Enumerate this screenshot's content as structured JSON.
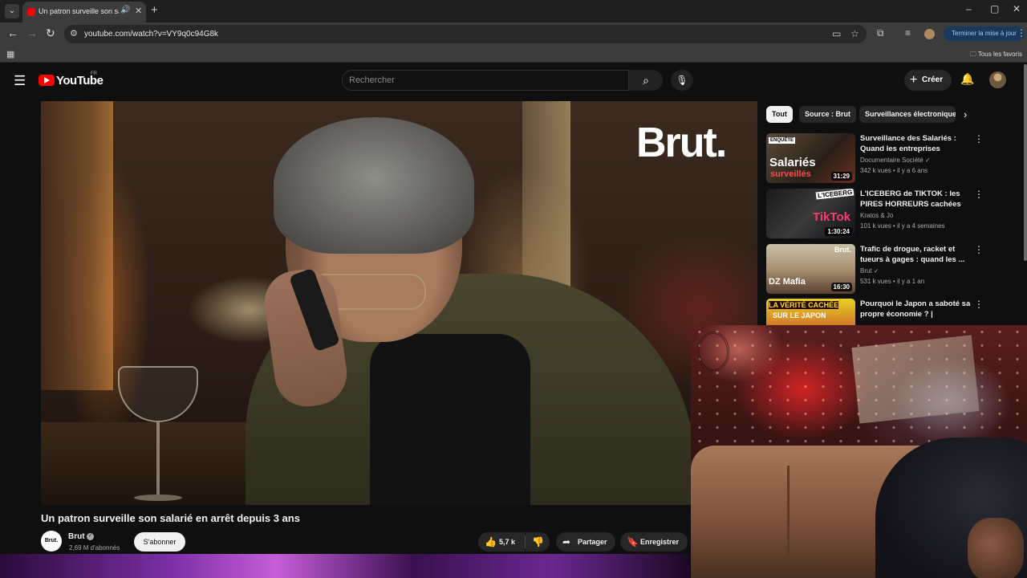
{
  "browser": {
    "tab_title": "Un patron surveille son salarié en arrêt depuis 3 ans",
    "url": "youtube.com/watch?v=VY9q0c94G8k",
    "update_button": "Terminer la mise à jour",
    "bookmarks_all": "Tous les favoris"
  },
  "youtube": {
    "logo_text": "YouTube",
    "country": "FR",
    "search_placeholder": "Rechercher",
    "create_label": "Créer"
  },
  "video": {
    "overlay_logo": "Brut.",
    "title": "Un patron surveille son salarié en arrêt depuis 3 ans",
    "channel_avatar_text": "Brut.",
    "channel": "Brut",
    "subscribers": "2,69 M d'abonnés",
    "subscribe_label": "S'abonner",
    "likes": "5,7 k",
    "share_label": "Partager",
    "save_label": "Enregistrer"
  },
  "chips": [
    "Tout",
    "Source : Brut",
    "Surveillances électroniques"
  ],
  "recommendations": [
    {
      "title": "Surveillance des Salariés : Quand les entreprises utilisent...",
      "channel": "Documentaire Société",
      "meta": "342 k vues • il y a 6 ans",
      "duration": "31:29",
      "thumb_badge": "ENQUÊTE",
      "thumb_text1": "Salariés",
      "thumb_text2": "surveillés"
    },
    {
      "title": "L'ICEBERG de TIKTOK : les PIRES HORREURS cachées de...",
      "channel": "Kratos & Jo",
      "meta": "101 k vues • il y a 4 semaines",
      "duration": "1:30:24",
      "thumb_text1": "L'ICEBERG",
      "thumb_text2": "TikTok"
    },
    {
      "title": "Trafic de drogue, racket et tueurs à gages : quand les ...",
      "channel": "Brut",
      "meta": "531 k vues • il y a 1 an",
      "duration": "16:30",
      "thumb_text1": "DZ Mafia",
      "thumb_text2": "Brut."
    },
    {
      "title": "Pourquoi le Japon a saboté sa propre économie ? | Profonde...",
      "channel": "",
      "meta": "",
      "duration": "",
      "thumb_text1": "LA VÉRITÉ CACHÉE",
      "thumb_text2": "SUR LE JAPON"
    }
  ]
}
